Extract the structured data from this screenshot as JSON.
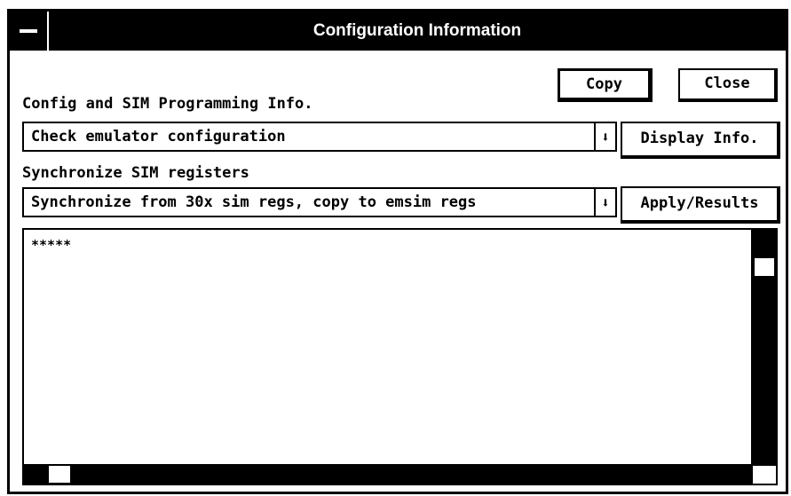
{
  "window": {
    "title": "Configuration Information"
  },
  "buttons": {
    "copy": "Copy",
    "close": "Close",
    "display_info": "Display Info.",
    "apply_results": "Apply/Results"
  },
  "config": {
    "label": "Config and SIM Programming Info.",
    "selected": "Check emulator configuration"
  },
  "sync": {
    "label": "Synchronize SIM registers",
    "selected": "Synchronize from 30x sim regs, copy to emsim regs"
  },
  "output": {
    "text": "*****"
  },
  "icons": {
    "dropdown": "down-arrow-icon",
    "system_menu": "system-menu-icon"
  }
}
